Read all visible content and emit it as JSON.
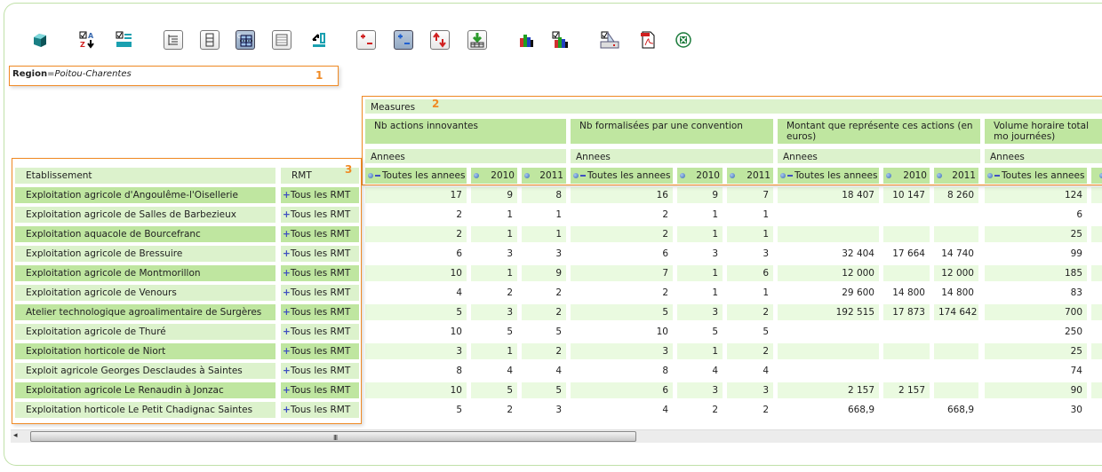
{
  "toolbar": {
    "icons": [
      "cube-icon",
      "sort-az-icon",
      "checklist-icon",
      "hierarchy-icon",
      "column-icon",
      "zero-suppress-icon",
      "table-icon",
      "swap-axes-icon",
      "expand-all-icon",
      "collapse-all-icon",
      "sort-updown-icon",
      "drill-through-icon",
      "chart-icon",
      "chart-config-icon",
      "print-icon",
      "pdf-icon",
      "excel-icon"
    ]
  },
  "filter": {
    "label": "Region",
    "op": "=",
    "value": "Poitou-Charentes",
    "marker": "1"
  },
  "measures": {
    "label": "Measures",
    "marker": "2",
    "groups": [
      {
        "name": "Nb actions innovantes",
        "dim": "Annees"
      },
      {
        "name": "Nb formalisées par une convention",
        "dim": "Annees"
      },
      {
        "name": "Montant que représente ces actions (en euros)",
        "dim": "Annees"
      },
      {
        "name": "Volume horaire total mo journées)",
        "dim": "Annees"
      }
    ],
    "years": [
      "Toutes les annees",
      "2010",
      "2011"
    ]
  },
  "rows_header": {
    "etab": "Etablissement",
    "rmt": "RMT",
    "marker": "3"
  },
  "rows": [
    {
      "etab": "Exploitation agricole d'Angoulême-l'Oisellerie",
      "rmt": "Tous les RMT",
      "v": [
        "17",
        "9",
        "8",
        "16",
        "9",
        "7",
        "18 407",
        "10 147",
        "8 260",
        "124"
      ]
    },
    {
      "etab": "Exploitation agricole de Salles de Barbezieux",
      "rmt": "Tous les RMT",
      "v": [
        "2",
        "1",
        "1",
        "2",
        "1",
        "1",
        "",
        "",
        "",
        "6"
      ]
    },
    {
      "etab": "Exploitation aquacole de Bourcefranc",
      "rmt": "Tous les RMT",
      "v": [
        "2",
        "1",
        "1",
        "2",
        "1",
        "1",
        "",
        "",
        "",
        "25"
      ]
    },
    {
      "etab": "Exploitation agricole de Bressuire",
      "rmt": "Tous les RMT",
      "v": [
        "6",
        "3",
        "3",
        "6",
        "3",
        "3",
        "32 404",
        "17 664",
        "14 740",
        "99"
      ]
    },
    {
      "etab": "Exploitation agricole de Montmorillon",
      "rmt": "Tous les RMT",
      "v": [
        "10",
        "1",
        "9",
        "7",
        "1",
        "6",
        "12 000",
        "",
        "12 000",
        "185"
      ]
    },
    {
      "etab": "Exploitation agricole de Venours",
      "rmt": "Tous les RMT",
      "v": [
        "4",
        "2",
        "2",
        "2",
        "1",
        "1",
        "29 600",
        "14 800",
        "14 800",
        "83"
      ]
    },
    {
      "etab": "Atelier technologique agroalimentaire de Surgères",
      "rmt": "Tous les RMT",
      "v": [
        "5",
        "3",
        "2",
        "5",
        "3",
        "2",
        "192 515",
        "17 873",
        "174 642",
        "700"
      ]
    },
    {
      "etab": "Exploitation agricole de Thuré",
      "rmt": "Tous les RMT",
      "v": [
        "10",
        "5",
        "5",
        "10",
        "5",
        "5",
        "",
        "",
        "",
        "250"
      ]
    },
    {
      "etab": "Exploitation horticole de Niort",
      "rmt": "Tous les RMT",
      "v": [
        "3",
        "1",
        "2",
        "3",
        "1",
        "2",
        "",
        "",
        "",
        "25"
      ]
    },
    {
      "etab": "Exploit agricole Georges Desclaudes à Saintes",
      "rmt": "Tous les RMT",
      "v": [
        "8",
        "4",
        "4",
        "8",
        "4",
        "4",
        "",
        "",
        "",
        "74"
      ]
    },
    {
      "etab": "Exploitation agricole Le Renaudin à Jonzac",
      "rmt": "Tous les RMT",
      "v": [
        "10",
        "5",
        "5",
        "6",
        "3",
        "3",
        "2 157",
        "2 157",
        "",
        "90"
      ]
    },
    {
      "etab": "Exploitation horticole Le Petit Chadignac Saintes",
      "rmt": "Tous les RMT",
      "v": [
        "5",
        "2",
        "3",
        "4",
        "2",
        "2",
        "668,9",
        "",
        "668,9",
        "30"
      ]
    }
  ],
  "scrollbar": {
    "grip": "III"
  }
}
